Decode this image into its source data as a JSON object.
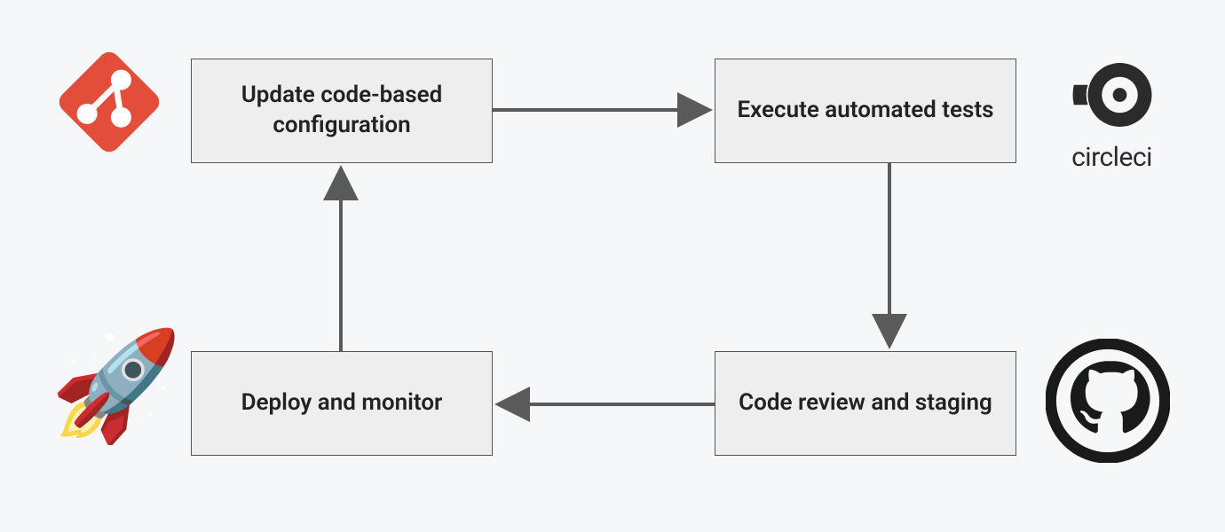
{
  "diagram": {
    "boxes": {
      "top_left": "Update code-based configuration",
      "top_right": "Execute automated tests",
      "bottom_right": "Code review and staging",
      "bottom_left": "Deploy and monitor"
    },
    "icons": {
      "git": "git-icon",
      "circleci_label": "circleci",
      "github": "github-icon",
      "rocket": "rocket-icon"
    },
    "flow": [
      {
        "from": "top_left",
        "to": "top_right"
      },
      {
        "from": "top_right",
        "to": "bottom_right"
      },
      {
        "from": "bottom_right",
        "to": "bottom_left"
      },
      {
        "from": "bottom_left",
        "to": "top_left"
      }
    ]
  }
}
